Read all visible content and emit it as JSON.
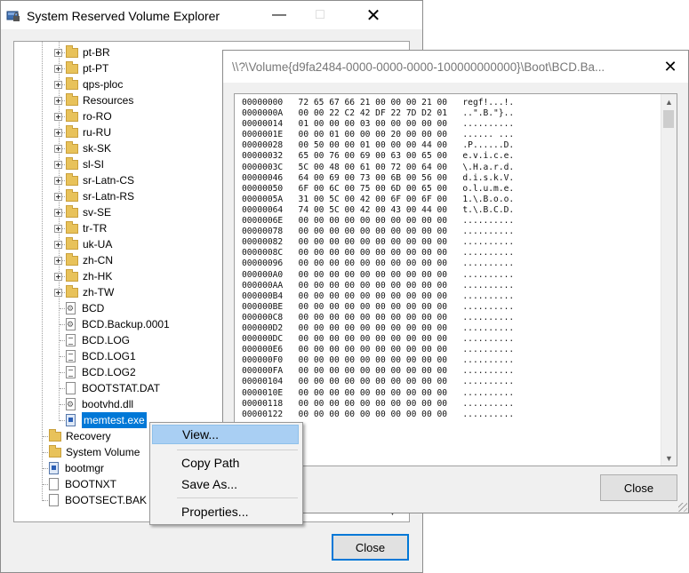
{
  "main_window": {
    "title": "System Reserved Volume Explorer",
    "tree": [
      {
        "label": "pt-BR",
        "kind": "folder",
        "expandable": true
      },
      {
        "label": "pt-PT",
        "kind": "folder",
        "expandable": true
      },
      {
        "label": "qps-ploc",
        "kind": "folder",
        "expandable": true
      },
      {
        "label": "Resources",
        "kind": "folder",
        "expandable": true
      },
      {
        "label": "ro-RO",
        "kind": "folder",
        "expandable": true
      },
      {
        "label": "ru-RU",
        "kind": "folder",
        "expandable": true
      },
      {
        "label": "sk-SK",
        "kind": "folder",
        "expandable": true
      },
      {
        "label": "sl-SI",
        "kind": "folder",
        "expandable": true
      },
      {
        "label": "sr-Latn-CS",
        "kind": "folder",
        "expandable": true
      },
      {
        "label": "sr-Latn-RS",
        "kind": "folder",
        "expandable": true
      },
      {
        "label": "sv-SE",
        "kind": "folder",
        "expandable": true
      },
      {
        "label": "tr-TR",
        "kind": "folder",
        "expandable": true
      },
      {
        "label": "uk-UA",
        "kind": "folder",
        "expandable": true
      },
      {
        "label": "zh-CN",
        "kind": "folder",
        "expandable": true
      },
      {
        "label": "zh-HK",
        "kind": "folder",
        "expandable": true
      },
      {
        "label": "zh-TW",
        "kind": "folder",
        "expandable": true
      },
      {
        "label": "BCD",
        "kind": "file-gear"
      },
      {
        "label": "BCD.Backup.0001",
        "kind": "file-gear"
      },
      {
        "label": "BCD.LOG",
        "kind": "file-lines"
      },
      {
        "label": "BCD.LOG1",
        "kind": "file-lines"
      },
      {
        "label": "BCD.LOG2",
        "kind": "file-lines"
      },
      {
        "label": "BOOTSTAT.DAT",
        "kind": "file"
      },
      {
        "label": "bootvhd.dll",
        "kind": "file-gear"
      },
      {
        "label": "memtest.exe",
        "kind": "file-exe",
        "selected": true
      },
      {
        "label": "Recovery",
        "kind": "folder"
      },
      {
        "label": "System Volume",
        "kind": "folder"
      },
      {
        "label": "bootmgr",
        "kind": "file-exe"
      },
      {
        "label": "BOOTNXT",
        "kind": "file"
      },
      {
        "label": "BOOTSECT.BAK",
        "kind": "file"
      }
    ],
    "close_label": "Close"
  },
  "hex_window": {
    "title": "\\\\?\\Volume{d9fa2484-0000-0000-0000-100000000000}\\Boot\\BCD.Ba...",
    "rows": [
      {
        "offset": "00000000",
        "bytes": "72 65 67 66 21 00 00 00 21 00",
        "ascii": "regf!...!."
      },
      {
        "offset": "0000000A",
        "bytes": "00 00 22 C2 42 DF 22 7D D2 01",
        "ascii": "..\".B.\"}.."
      },
      {
        "offset": "00000014",
        "bytes": "01 00 00 00 03 00 00 00 00 00",
        "ascii": ".........."
      },
      {
        "offset": "0000001E",
        "bytes": "00 00 01 00 00 00 20 00 00 00",
        "ascii": "...... ..."
      },
      {
        "offset": "00000028",
        "bytes": "00 50 00 00 01 00 00 00 44 00",
        "ascii": ".P......D."
      },
      {
        "offset": "00000032",
        "bytes": "65 00 76 00 69 00 63 00 65 00",
        "ascii": "e.v.i.c.e."
      },
      {
        "offset": "0000003C",
        "bytes": "5C 00 48 00 61 00 72 00 64 00",
        "ascii": "\\.H.a.r.d."
      },
      {
        "offset": "00000046",
        "bytes": "64 00 69 00 73 00 6B 00 56 00",
        "ascii": "d.i.s.k.V."
      },
      {
        "offset": "00000050",
        "bytes": "6F 00 6C 00 75 00 6D 00 65 00",
        "ascii": "o.l.u.m.e."
      },
      {
        "offset": "0000005A",
        "bytes": "31 00 5C 00 42 00 6F 00 6F 00",
        "ascii": "1.\\.B.o.o."
      },
      {
        "offset": "00000064",
        "bytes": "74 00 5C 00 42 00 43 00 44 00",
        "ascii": "t.\\.B.C.D."
      },
      {
        "offset": "0000006E",
        "bytes": "00 00 00 00 00 00 00 00 00 00",
        "ascii": ".........."
      },
      {
        "offset": "00000078",
        "bytes": "00 00 00 00 00 00 00 00 00 00",
        "ascii": ".........."
      },
      {
        "offset": "00000082",
        "bytes": "00 00 00 00 00 00 00 00 00 00",
        "ascii": ".........."
      },
      {
        "offset": "0000008C",
        "bytes": "00 00 00 00 00 00 00 00 00 00",
        "ascii": ".........."
      },
      {
        "offset": "00000096",
        "bytes": "00 00 00 00 00 00 00 00 00 00",
        "ascii": ".........."
      },
      {
        "offset": "000000A0",
        "bytes": "00 00 00 00 00 00 00 00 00 00",
        "ascii": ".........."
      },
      {
        "offset": "000000AA",
        "bytes": "00 00 00 00 00 00 00 00 00 00",
        "ascii": ".........."
      },
      {
        "offset": "000000B4",
        "bytes": "00 00 00 00 00 00 00 00 00 00",
        "ascii": ".........."
      },
      {
        "offset": "000000BE",
        "bytes": "00 00 00 00 00 00 00 00 00 00",
        "ascii": ".........."
      },
      {
        "offset": "000000C8",
        "bytes": "00 00 00 00 00 00 00 00 00 00",
        "ascii": ".........."
      },
      {
        "offset": "000000D2",
        "bytes": "00 00 00 00 00 00 00 00 00 00",
        "ascii": ".........."
      },
      {
        "offset": "000000DC",
        "bytes": "00 00 00 00 00 00 00 00 00 00",
        "ascii": ".........."
      },
      {
        "offset": "000000E6",
        "bytes": "00 00 00 00 00 00 00 00 00 00",
        "ascii": ".........."
      },
      {
        "offset": "000000F0",
        "bytes": "00 00 00 00 00 00 00 00 00 00",
        "ascii": ".........."
      },
      {
        "offset": "000000FA",
        "bytes": "00 00 00 00 00 00 00 00 00 00",
        "ascii": ".........."
      },
      {
        "offset": "00000104",
        "bytes": "00 00 00 00 00 00 00 00 00 00",
        "ascii": ".........."
      },
      {
        "offset": "0000010E",
        "bytes": "00 00 00 00 00 00 00 00 00 00",
        "ascii": ".........."
      },
      {
        "offset": "00000118",
        "bytes": "00 00 00 00 00 00 00 00 00 00",
        "ascii": ".........."
      },
      {
        "offset": "00000122",
        "bytes": "00 00 00 00 00 00 00 00 00 00",
        "ascii": ".........."
      }
    ],
    "close_label": "Close"
  },
  "context_menu": {
    "items": [
      {
        "label": "View...",
        "highlighted": true
      },
      {
        "label": "Copy Path"
      },
      {
        "label": "Save As..."
      },
      {
        "label": "Properties..."
      }
    ]
  },
  "colors": {
    "selection": "#0078d7",
    "menu_highlight": "#a9cff3",
    "folder": "#e8c25a"
  },
  "icons": {
    "app": "drive-lock-icon",
    "minimize": "minimize-icon",
    "maximize": "maximize-icon",
    "close": "close-icon"
  }
}
